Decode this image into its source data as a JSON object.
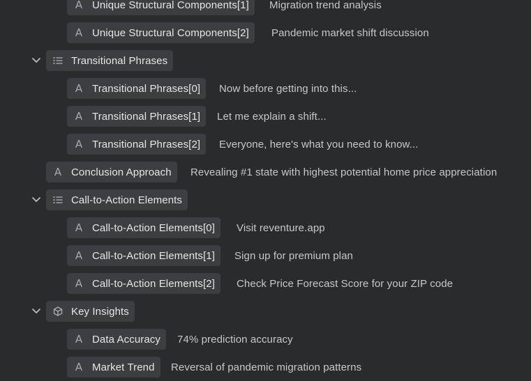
{
  "colors": {
    "background": "#2a2b2d",
    "chip_background": "#3d3e41",
    "key_text": "#e6e6e6",
    "value_text": "#c8c8c8",
    "icon": "#a9a9ab"
  },
  "rows": [
    {
      "kind": "string",
      "icon": "text-type-icon",
      "icon_glyph": "A",
      "key": "Unique Structural Components[1]",
      "value": "Migration trend analysis"
    },
    {
      "kind": "string",
      "icon": "text-type-icon",
      "icon_glyph": "A",
      "key": "Unique Structural Components[2]",
      "value": "Pandemic market shift discussion"
    },
    {
      "kind": "array",
      "icon": "list-icon",
      "key": "Transitional Phrases",
      "expanded": true
    },
    {
      "kind": "string",
      "icon": "text-type-icon",
      "icon_glyph": "A",
      "key": "Transitional Phrases[0]",
      "value": "Now before getting into this..."
    },
    {
      "kind": "string",
      "icon": "text-type-icon",
      "icon_glyph": "A",
      "key": "Transitional Phrases[1]",
      "value": "Let me explain a shift..."
    },
    {
      "kind": "string",
      "icon": "text-type-icon",
      "icon_glyph": "A",
      "key": "Transitional Phrases[2]",
      "value": "Everyone, here's what you need to know..."
    },
    {
      "kind": "string",
      "icon": "text-type-icon",
      "icon_glyph": "A",
      "key": "Conclusion Approach",
      "value": "Revealing #1 state with highest potential home price appreciation"
    },
    {
      "kind": "array",
      "icon": "list-icon",
      "key": "Call-to-Action Elements",
      "expanded": true
    },
    {
      "kind": "string",
      "icon": "text-type-icon",
      "icon_glyph": "A",
      "key": "Call-to-Action Elements[0]",
      "value": "Visit reventure.app"
    },
    {
      "kind": "string",
      "icon": "text-type-icon",
      "icon_glyph": "A",
      "key": "Call-to-Action Elements[1]",
      "value": "Sign up for premium plan"
    },
    {
      "kind": "string",
      "icon": "text-type-icon",
      "icon_glyph": "A",
      "key": "Call-to-Action Elements[2]",
      "value": "Check Price Forecast Score for your ZIP code"
    },
    {
      "kind": "object",
      "icon": "cube-icon",
      "key": "Key Insights",
      "expanded": true
    },
    {
      "kind": "string",
      "icon": "text-type-icon",
      "icon_glyph": "A",
      "key": "Data Accuracy",
      "value": "74% prediction accuracy"
    },
    {
      "kind": "string",
      "icon": "text-type-icon",
      "icon_glyph": "A",
      "key": "Market Trend",
      "value": "Reversal of pandemic migration patterns"
    }
  ]
}
